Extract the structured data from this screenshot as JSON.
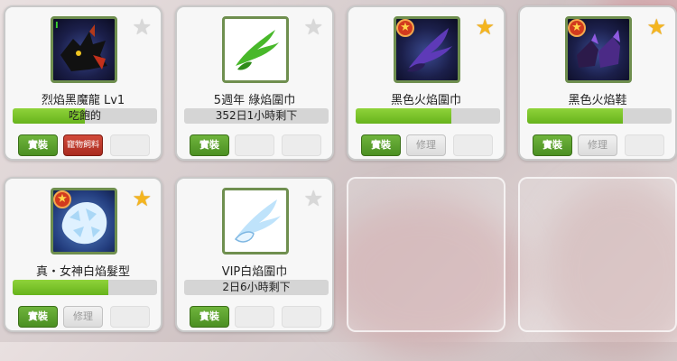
{
  "cards": [
    {
      "name": "烈焰黑魔龍 Lv1",
      "bar_text": "吃飽的",
      "bar_fill": 0.5,
      "star": "off",
      "icon": "black-dragon-icon",
      "buttons": [
        "實裝",
        "寵物飼料",
        ""
      ],
      "button_styles": [
        "green",
        "red",
        "blank"
      ]
    },
    {
      "name": "5週年 綠焰圍巾",
      "bar_text": "352日1小時剩下",
      "bar_fill": 0,
      "star": "off",
      "icon": "green-wing-scarf-icon",
      "buttons": [
        "實裝",
        "",
        ""
      ],
      "button_styles": [
        "green",
        "blank",
        "blank"
      ]
    },
    {
      "name": "黑色火焰圍巾",
      "bar_text": "",
      "bar_fill": 0.66,
      "star": "on",
      "icon": "dark-flame-scarf-icon",
      "buttons": [
        "實裝",
        "修理",
        ""
      ],
      "button_styles": [
        "green",
        "gray",
        "blank"
      ]
    },
    {
      "name": "黑色火焰鞋",
      "bar_text": "",
      "bar_fill": 0.66,
      "star": "on",
      "icon": "dark-flame-shoes-icon",
      "buttons": [
        "實裝",
        "修理",
        ""
      ],
      "button_styles": [
        "green",
        "gray",
        "blank"
      ]
    },
    {
      "name": "真・女神白焰髮型",
      "bar_text": "",
      "bar_fill": 0.66,
      "star": "on",
      "icon": "white-flame-hair-icon",
      "buttons": [
        "實裝",
        "修理",
        ""
      ],
      "button_styles": [
        "green",
        "gray",
        "blank"
      ]
    },
    {
      "name": "VIP白焰圍巾",
      "bar_text": "2日6小時剩下",
      "bar_fill": 0,
      "star": "off",
      "icon": "white-wing-scarf-icon",
      "buttons": [
        "實裝",
        "",
        ""
      ],
      "button_styles": [
        "green",
        "blank",
        "blank"
      ]
    }
  ],
  "empty_slots": 2,
  "colors": {
    "equip_green": "#5aa02c",
    "bar_green": "#7cc42b",
    "star_gold": "#f4b51f",
    "badge_red": "#d23a1e"
  }
}
